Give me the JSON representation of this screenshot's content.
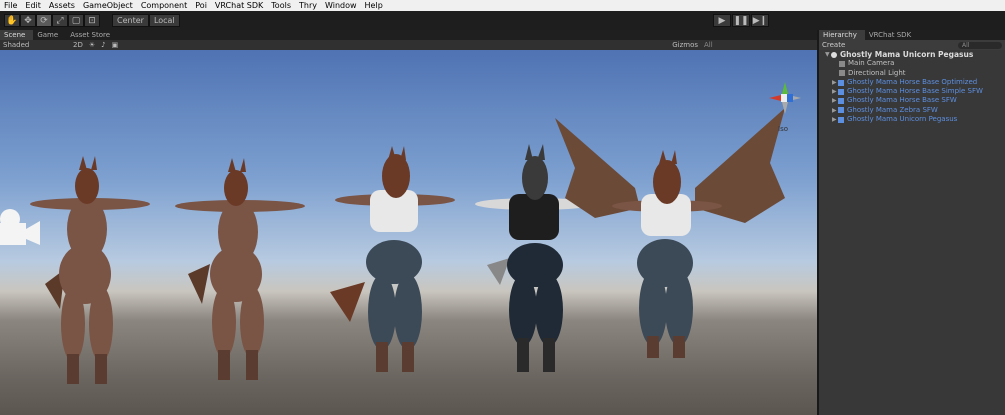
{
  "menu": [
    "File",
    "Edit",
    "Assets",
    "GameObject",
    "Component",
    "Poi",
    "VRChat SDK",
    "Tools",
    "Thry",
    "Window",
    "Help"
  ],
  "toolbar": {
    "pivot_center": "Center",
    "pivot_local": "Local"
  },
  "scene_tabs": [
    "Scene",
    "Game",
    "Asset Store"
  ],
  "scene_bar": {
    "shading": "Shaded",
    "mode_2d": "2D",
    "gizmos": "Gizmos",
    "search": "All"
  },
  "gizmo_label": "Iso",
  "hierarchy": {
    "tabs": [
      "Hierarchy",
      "VRChat SDK"
    ],
    "create": "Create",
    "search": "All",
    "root": "Ghostly Mama Unicorn Pegasus",
    "items": [
      {
        "label": "Main Camera",
        "type": "plain"
      },
      {
        "label": "Directional Light",
        "type": "plain"
      },
      {
        "label": "Ghostly Mama Horse Base Optimized",
        "type": "prefab"
      },
      {
        "label": "Ghostly Mama Horse Base Simple SFW",
        "type": "prefab"
      },
      {
        "label": "Ghostly Mama Horse Base SFW",
        "type": "prefab"
      },
      {
        "label": "Ghostly Mama Zebra SFW",
        "type": "prefab"
      },
      {
        "label": "Ghostly Mama Unicorn Pegasus",
        "type": "prefab"
      }
    ]
  },
  "colors": {
    "prefab_text": "#5d8fe0",
    "fur": "#7a5445",
    "hair": "#6a3a26",
    "jeans": "#3c4a58",
    "zebra": "#3a3a3a"
  }
}
